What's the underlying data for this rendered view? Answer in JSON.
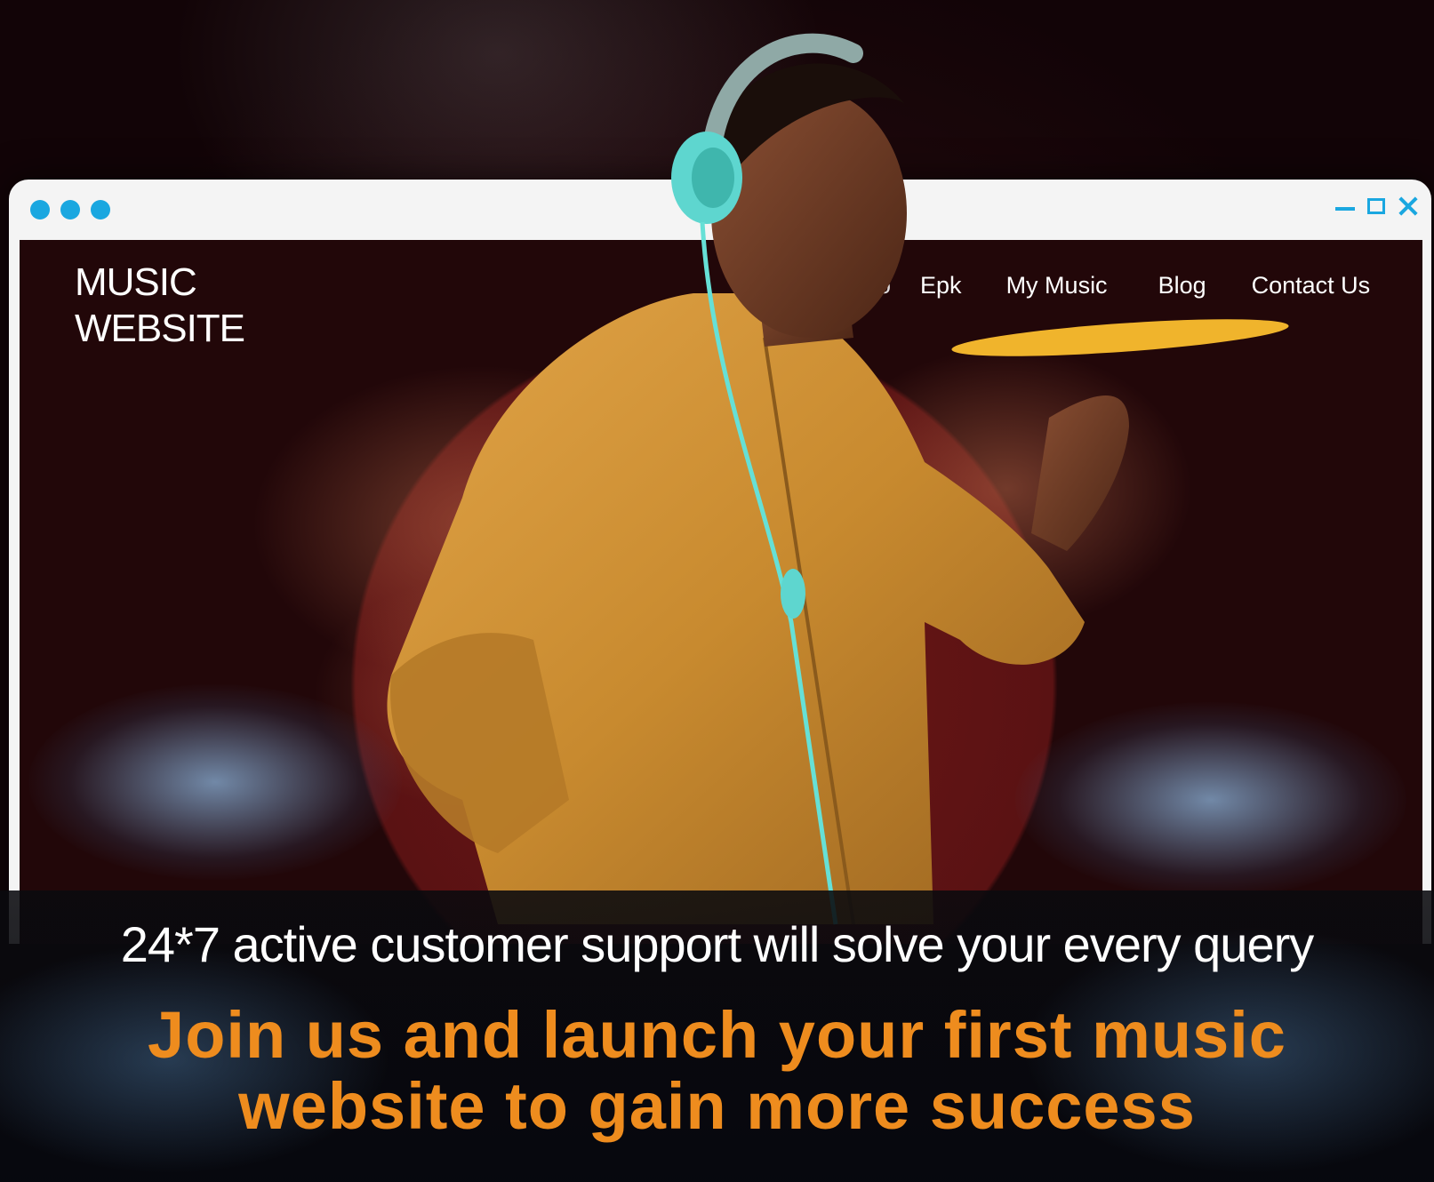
{
  "browser": {
    "controls": [
      "minimize-icon",
      "maximize-icon",
      "close-icon"
    ],
    "accent_color": "#1aa7e0"
  },
  "site": {
    "logo_line1": "MUSIC",
    "logo_line2": "WEBSITE",
    "nav": [
      {
        "label": "o"
      },
      {
        "label": "Epk"
      },
      {
        "label": "My Music"
      },
      {
        "label": "Blog"
      },
      {
        "label": "Contact Us"
      }
    ]
  },
  "banner": {
    "support_text": "24*7 active customer support will solve your every query",
    "cta_line1": "Join us and launch your first music",
    "cta_line2": "website to gain more success",
    "cta_color": "#ee8c1e"
  }
}
